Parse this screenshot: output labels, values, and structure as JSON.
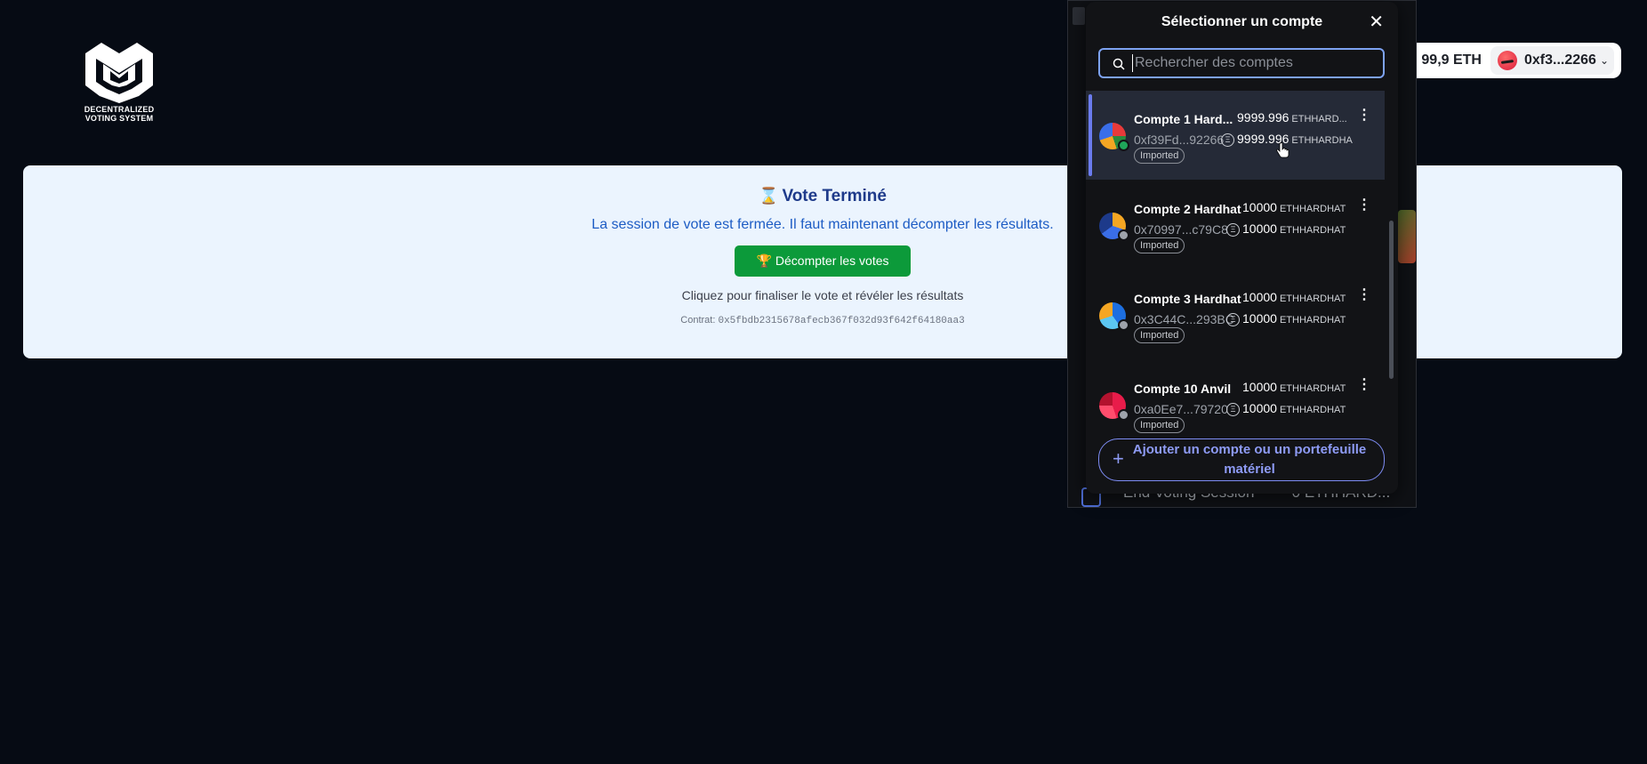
{
  "logo": {
    "line1": "DECENTRALIZED",
    "line2": "VOTING SYSTEM"
  },
  "wallet": {
    "balance": "99,9 ETH",
    "address": "0xf3...2266",
    "chevron": "⌄"
  },
  "vote": {
    "hourglass": "⌛",
    "title": "Vote Terminé",
    "subtitle": "La session de vote est fermée. Il faut maintenant décompter les résultats.",
    "trophy": "🏆",
    "button_label": "Décompter les votes",
    "hint": "Cliquez pour finaliser le vote et révéler les résultats",
    "contract_label": "Contrat:",
    "contract_address": "0x5fbdb2315678afecb367f032d93f642f64180aa3"
  },
  "extension_bg": {
    "activity_label": "End Voting Session",
    "activity_amount": "-0 ETHHARD..."
  },
  "popup": {
    "title": "Sélectionner un compte",
    "close": "✕",
    "search_placeholder": "Rechercher des comptes",
    "add_account_label": "Ajouter un compte ou un portefeuille matériel",
    "accounts": [
      {
        "name": "Compte 1 Hard...",
        "address": "0xf39Fd...92266",
        "balance1": "9999.996",
        "unit1": "ETHHARD...",
        "balance2": "9999.996",
        "unit2": "ETHHARDHA",
        "tag": "Imported",
        "selected": true,
        "status_color": "#1fa65a"
      },
      {
        "name": "Compte 2 Hardhat",
        "address": "0x70997...c79C8",
        "balance1": "10000",
        "unit1": "ETHHARDHAT",
        "balance2": "10000",
        "unit2": "ETHHARDHAT",
        "tag": "Imported",
        "selected": false,
        "status_color": "#9ea3ab"
      },
      {
        "name": "Compte 3 Hardhat",
        "address": "0x3C44C...293BC",
        "balance1": "10000",
        "unit1": "ETHHARDHAT",
        "balance2": "10000",
        "unit2": "ETHHARDHAT",
        "tag": "Imported",
        "selected": false,
        "status_color": "#9ea3ab"
      },
      {
        "name": "Compte 10 Anvil",
        "address": "0xa0Ee7...79720",
        "balance1": "10000",
        "unit1": "ETHHARDHAT",
        "balance2": "10000",
        "unit2": "ETHHARDHAT",
        "tag": "Imported",
        "selected": false,
        "status_color": "#9ea3ab"
      }
    ]
  },
  "colors": {
    "background": "#060b14",
    "card": "#ebf4fe",
    "title": "#1e3a8a",
    "button": "#0c9a3a",
    "popup_bg": "#121316",
    "accent": "#7d8cf3"
  }
}
